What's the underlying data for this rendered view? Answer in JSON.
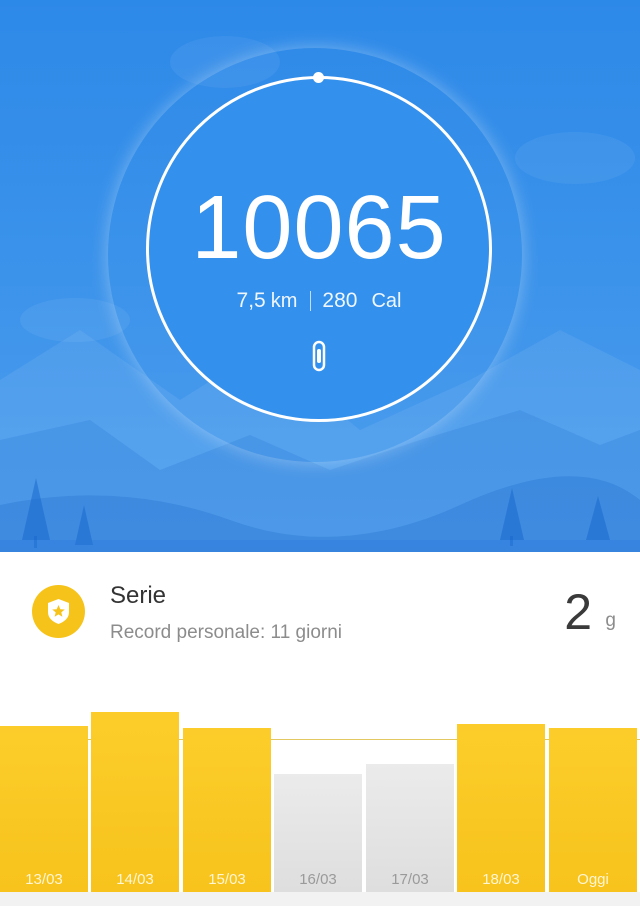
{
  "hero": {
    "steps": "10065",
    "distance_value": "7,5",
    "distance_unit": "km",
    "calories_value": "280",
    "calories_unit": "Cal",
    "goal_progress": 1.0
  },
  "streak": {
    "title": "Serie",
    "subtitle": "Record personale: 11 giorni",
    "count": "2",
    "unit": "g"
  },
  "days": [
    {
      "label": "13/03",
      "value": 0.83,
      "goal_met": true
    },
    {
      "label": "14/03",
      "value": 0.9,
      "goal_met": true
    },
    {
      "label": "15/03",
      "value": 0.82,
      "goal_met": true
    },
    {
      "label": "16/03",
      "value": 0.59,
      "goal_met": false
    },
    {
      "label": "17/03",
      "value": 0.64,
      "goal_met": false
    },
    {
      "label": "18/03",
      "value": 0.84,
      "goal_met": true
    },
    {
      "label": "Oggi",
      "value": 0.82,
      "goal_met": true
    }
  ],
  "colors": {
    "hero_blue": "#3390ec",
    "accent_yellow": "#f7c31c",
    "missed_gray": "#e4e4e4"
  }
}
